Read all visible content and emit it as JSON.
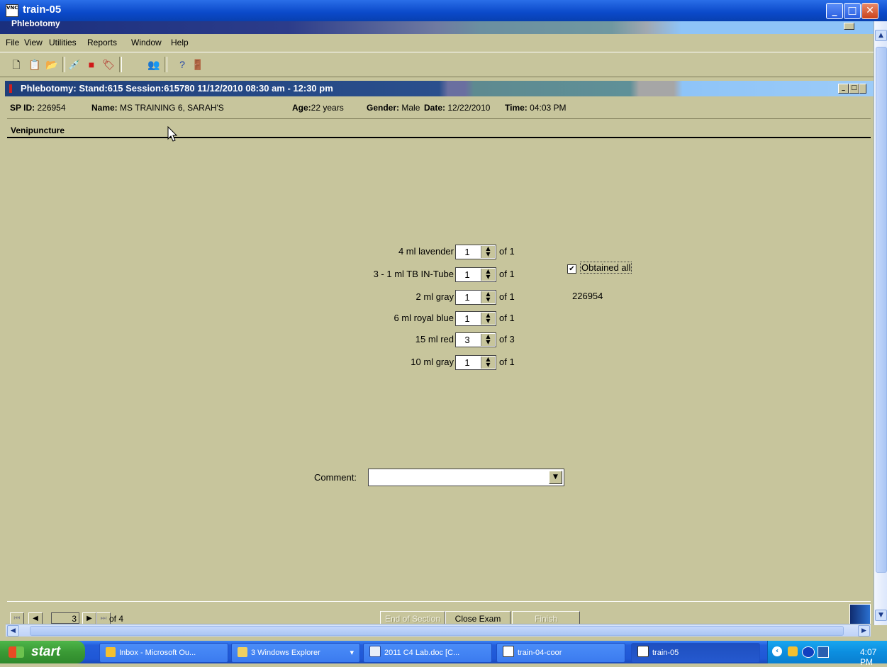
{
  "window": {
    "title": "train-05",
    "vnc_icon": "vnc-icon"
  },
  "app": {
    "title": "Phlebotomy"
  },
  "menu": [
    "File",
    "View",
    "Utilities",
    "Reports",
    "Window",
    "Help"
  ],
  "toolbar": [
    "new-icon",
    "clipboard-icon",
    "open-icon",
    "syringe-icon",
    "stop-icon",
    "tag-icon",
    "people-icon",
    "help-icon",
    "exit-icon"
  ],
  "session": {
    "title": "Phlebotomy: Stand:615 Session:615780 11/12/2010 08:30 am - 12:30 pm"
  },
  "participant": {
    "sp_id_label": "SP ID:",
    "sp_id": "226954",
    "name_label": "Name:",
    "name": "MS TRAINING 6, SARAH'S",
    "age_label": "Age:",
    "age": "22 years",
    "gender_label": "Gender:",
    "gender": "Male",
    "date_label": "Date:",
    "date": "12/22/2010",
    "time_label": "Time:",
    "time": "04:03 PM"
  },
  "section": {
    "title": "Venipuncture"
  },
  "tubes": [
    {
      "label": "4 ml lavender",
      "value": "1",
      "of": "of 1"
    },
    {
      "label": "3 - 1 ml TB IN-Tube",
      "value": "1",
      "of": "of 1"
    },
    {
      "label": "2 ml gray",
      "value": "1",
      "of": "of 1"
    },
    {
      "label": "6 ml royal blue",
      "value": "1",
      "of": "of 1"
    },
    {
      "label": "15 ml red",
      "value": "3",
      "of": "of 3"
    },
    {
      "label": "10 ml gray",
      "value": "1",
      "of": "of 1"
    }
  ],
  "obtained": {
    "label": "Obtained all",
    "checked": true,
    "sp_number": "226954"
  },
  "comment": {
    "label": "Comment:",
    "value": ""
  },
  "nav": {
    "page": "3",
    "of": "of 4"
  },
  "buttons": {
    "end_of_section": "End of Section",
    "close_exam": "Close Exam",
    "finish": "Finish"
  },
  "taskbar": {
    "start": "start",
    "tasks": [
      {
        "label": "Inbox - Microsoft Ou...",
        "icon": "outlook-icon"
      },
      {
        "label": "3 Windows Explorer",
        "icon": "folder-icon"
      },
      {
        "label": "2011 C4 Lab.doc [C...",
        "icon": "word-icon"
      },
      {
        "label": "train-04-coor",
        "icon": "vnc-icon"
      },
      {
        "label": "train-05",
        "icon": "vnc-icon"
      }
    ],
    "clock": "4:07 PM"
  }
}
